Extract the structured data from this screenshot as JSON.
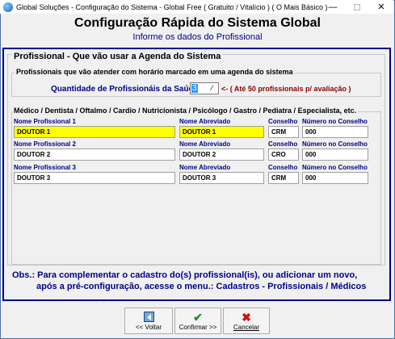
{
  "window": {
    "title": "Global Soluções - Configuração do Sistema - Global Free ( Gratuito / Vitalício ) ( O Mais Básico )",
    "minimize": "—",
    "close": "✕"
  },
  "header": {
    "title": "Configuração Rápida do Sistema Global",
    "subtitle": "Informe os dados do Profissional"
  },
  "group_main": {
    "title": "Profissional - Que vão usar a Agenda do Sistema"
  },
  "group_qty": {
    "title": "Profissionais que vão atender com horário marcado em uma agenda do sistema",
    "label": "Quantidade de Profissionáis da Saúde",
    "value": "3",
    "spin": "⁄",
    "hint": "<- ( Até 50 profissionais p/ avaliação )"
  },
  "group_prof": {
    "title": "Médico / Dentista / Oftalmo / Cardio / Nutricionista / Psicólogo / Gastro / Pediatra / Especialista, etc."
  },
  "professionals": [
    {
      "label_name": "Nome Profissional 1",
      "name": "DOUTOR 1",
      "label_short": "Nome Abreviado",
      "short": "DOUTOR 1",
      "label_council": "Conselho",
      "council": "CRM",
      "label_number": "Número no Conselho",
      "number": "000"
    },
    {
      "label_name": "Nome Profissional 2",
      "name": "DOUTOR 2",
      "label_short": "Nome Abreviado",
      "short": "DOUTOR 2",
      "label_council": "Conselho",
      "council": "CRO",
      "label_number": "Número no Conselho",
      "number": "000"
    },
    {
      "label_name": "Nome Profissional 3",
      "name": "DOUTOR 3",
      "label_short": "Nome Abreviado",
      "short": "DOUTOR 3",
      "label_council": "Conselho",
      "council": "CRM",
      "label_number": "Número no Conselho",
      "number": "000"
    }
  ],
  "obs": {
    "line1": "Obs.: Para complementar o cadastro do(s) profissional(is), ou adicionar um novo,",
    "line2": "após a pré-configuração, acesse o menu.: Cadastros - Profissionais / Médicos"
  },
  "buttons": {
    "voltar": "<< Voltar",
    "confirmar": "Confirmar >>",
    "cancelar": "Cancelar"
  },
  "colors": {
    "accent": "#00008b",
    "highlight": "#ffff00",
    "hint": "#8b0000"
  }
}
